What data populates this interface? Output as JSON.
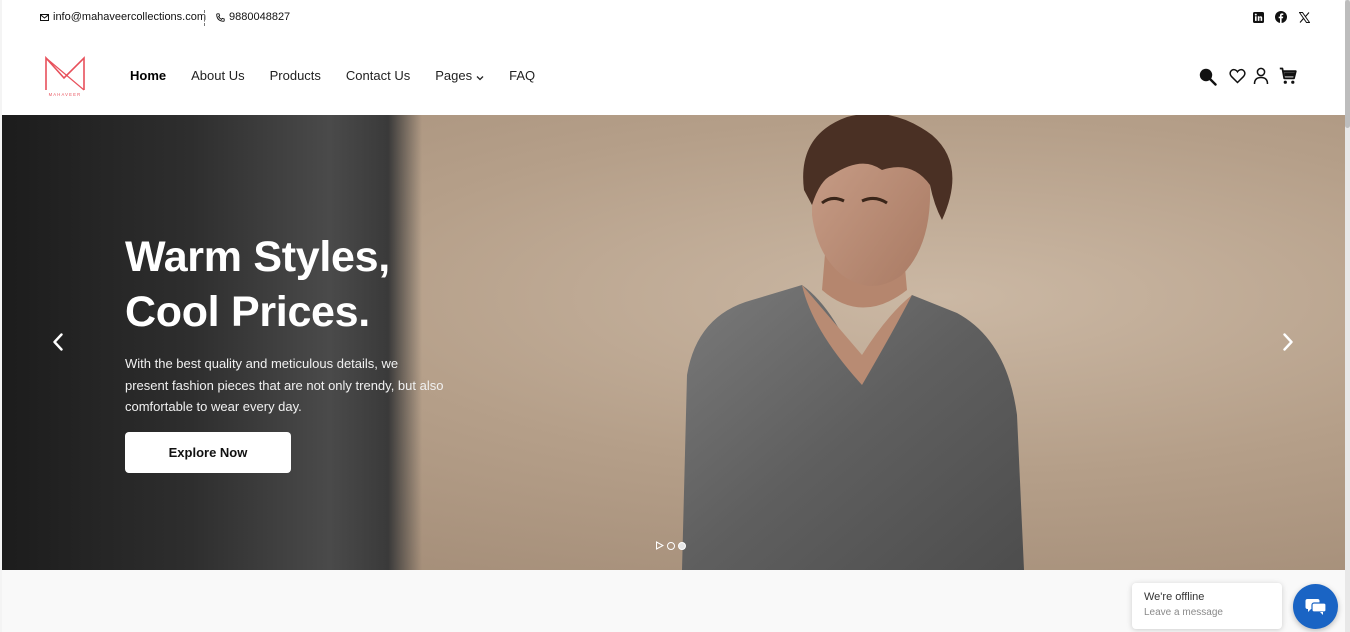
{
  "topbar": {
    "email": "info@mahaveercollections.com",
    "phone": "9880048827",
    "social_icons": [
      "linkedin-icon",
      "facebook-icon",
      "x-twitter-icon"
    ]
  },
  "header": {
    "logo_text": "MAHAVEER",
    "nav": [
      {
        "label": "Home",
        "active": true
      },
      {
        "label": "About Us",
        "active": false
      },
      {
        "label": "Products",
        "active": false
      },
      {
        "label": "Contact Us",
        "active": false
      },
      {
        "label": "Pages",
        "active": false,
        "dropdown": true
      },
      {
        "label": "FAQ",
        "active": false
      }
    ],
    "icons": [
      "search-icon",
      "heart-icon",
      "user-icon",
      "cart-icon"
    ],
    "accent_color": "#e8505b"
  },
  "hero": {
    "title_line1": "Warm Styles,",
    "title_line2": "Cool Prices.",
    "description_line1": "With the best quality and meticulous details, we",
    "description_line2": "present fashion pieces that are not only trendy, but also",
    "description_line3": "comfortable to wear every day.",
    "cta_label": "Explore Now",
    "slide_count": 2,
    "active_slide": 1
  },
  "chat": {
    "status": "We're offline",
    "prompt": "Leave a message",
    "button_color": "#1a64c4"
  }
}
